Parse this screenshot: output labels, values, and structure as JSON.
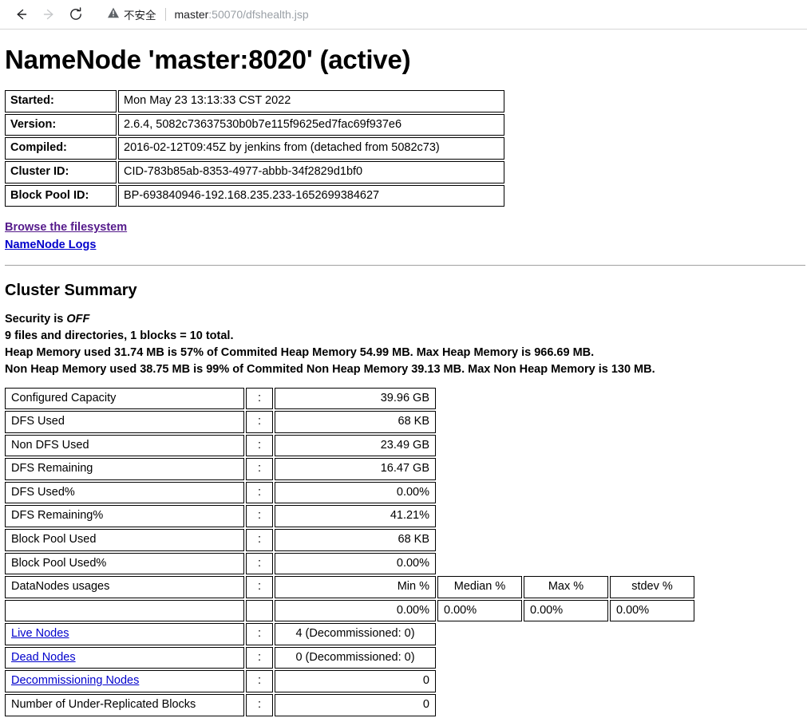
{
  "browser": {
    "back_icon": "back-arrow-icon",
    "forward_icon": "forward-arrow-icon",
    "reload_icon": "reload-icon",
    "security_icon": "warning-triangle-icon",
    "security_label": "不安全",
    "url_host": "master",
    "url_path": ":50070/dfshealth.jsp"
  },
  "page": {
    "title": "NameNode 'master:8020' (active)",
    "section_title": "Cluster Summary"
  },
  "info_table": {
    "rows": [
      {
        "key": "Started:",
        "value": "Mon May 23 13:13:33 CST 2022"
      },
      {
        "key": "Version:",
        "value": "2.6.4, 5082c73637530b0b7e115f9625ed7fac69f937e6"
      },
      {
        "key": "Compiled:",
        "value": "2016-02-12T09:45Z by jenkins from (detached from 5082c73)"
      },
      {
        "key": "Cluster ID:",
        "value": "CID-783b85ab-8353-4977-abbb-34f2829d1bf0"
      },
      {
        "key": "Block Pool ID:",
        "value": "BP-693840946-192.168.235.233-1652699384627"
      }
    ]
  },
  "links": [
    {
      "label": "Browse the filesystem",
      "state": "visited"
    },
    {
      "label": "NameNode Logs",
      "state": "unvisited"
    }
  ],
  "summary": {
    "security_prefix": "Security is ",
    "security_state": "OFF",
    "files_line": "9 files and directories, 1 blocks = 10 total.",
    "heap_line": "Heap Memory used 31.74 MB is 57% of Commited Heap Memory 54.99 MB. Max Heap Memory is 966.69 MB.",
    "non_heap_line": "Non Heap Memory used 38.75 MB is 99% of Commited Non Heap Memory 39.13 MB. Max Non Heap Memory is 130 MB."
  },
  "stats_table": {
    "colon": ":",
    "rows": [
      {
        "label": "Configured Capacity",
        "colon": ":",
        "value": "39.96 GB",
        "align": "right"
      },
      {
        "label": "DFS Used",
        "colon": ":",
        "value": "68 KB",
        "align": "right"
      },
      {
        "label": "Non DFS Used",
        "colon": ":",
        "value": "23.49 GB",
        "align": "right"
      },
      {
        "label": "DFS Remaining",
        "colon": ":",
        "value": "16.47 GB",
        "align": "right"
      },
      {
        "label": "DFS Used%",
        "colon": ":",
        "value": "0.00%",
        "align": "right"
      },
      {
        "label": "DFS Remaining%",
        "colon": ":",
        "value": "41.21%",
        "align": "right"
      },
      {
        "label": "Block Pool Used",
        "colon": ":",
        "value": "68 KB",
        "align": "right"
      },
      {
        "label": "Block Pool Used%",
        "colon": ":",
        "value": "0.00%",
        "align": "right"
      }
    ],
    "usages_header": {
      "label": "DataNodes usages",
      "colon": ":",
      "min": "Min %",
      "median": "Median %",
      "max": "Max %",
      "stdev": "stdev %"
    },
    "usages_values": {
      "label": "",
      "colon": "",
      "min": "0.00%",
      "median": "0.00%",
      "max": "0.00%",
      "stdev": "0.00%"
    },
    "node_rows": [
      {
        "label": "Live Nodes",
        "link": true,
        "colon": ":",
        "value": "4 (Decommissioned: 0)",
        "align": "center"
      },
      {
        "label": "Dead Nodes",
        "link": true,
        "colon": ":",
        "value": "0 (Decommissioned: 0)",
        "align": "center"
      },
      {
        "label": "Decommissioning Nodes",
        "link": true,
        "colon": ":",
        "value": "0",
        "align": "right"
      },
      {
        "label": "Number of Under-Replicated Blocks",
        "link": false,
        "colon": ":",
        "value": "0",
        "align": "right"
      }
    ]
  }
}
